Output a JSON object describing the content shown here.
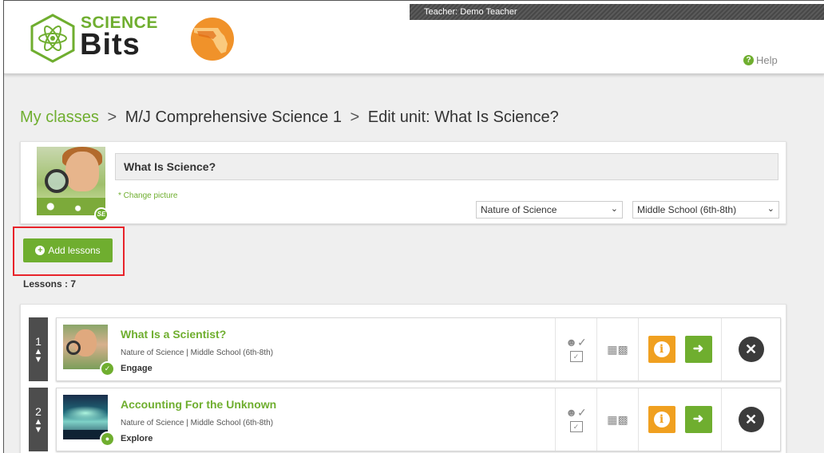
{
  "header": {
    "teacher_label": "Teacher: Demo Teacher",
    "logo_top": "SCIENCE",
    "logo_bottom": "Bits",
    "help_label": "Help"
  },
  "breadcrumb": {
    "root": "My classes",
    "separator": ">",
    "course": "M/J Comprehensive Science 1",
    "current": "Edit unit: What Is Science?"
  },
  "unit": {
    "title_value": "What Is Science?",
    "change_picture": "* Change picture",
    "badge": "SE",
    "subject_select": "Nature of Science",
    "level_select": "Middle School (6th-8th)"
  },
  "add_lessons_label": "Add lessons",
  "lessons_count_label": "Lessons : 7",
  "lessons": [
    {
      "number": "1",
      "title": "What Is a Scientist?",
      "meta": "Nature of Science | Middle School (6th-8th)",
      "stage": "Engage"
    },
    {
      "number": "2",
      "title": "Accounting For the Unknown",
      "meta": "Nature of Science | Middle School (6th-8th)",
      "stage": "Explore"
    }
  ],
  "colors": {
    "brand_green": "#6fae2f",
    "info_orange": "#f0a020",
    "highlight_red": "#e8232a",
    "dark": "#3b3b3b"
  },
  "icons": {
    "help": "help-circle-icon",
    "add": "plus-circle-icon",
    "reorder": "up-down-arrows-icon",
    "assign": "student-check-icon",
    "present": "presentation-icon",
    "info": "info-icon",
    "enter": "sign-in-icon",
    "remove": "close-circle-icon"
  }
}
